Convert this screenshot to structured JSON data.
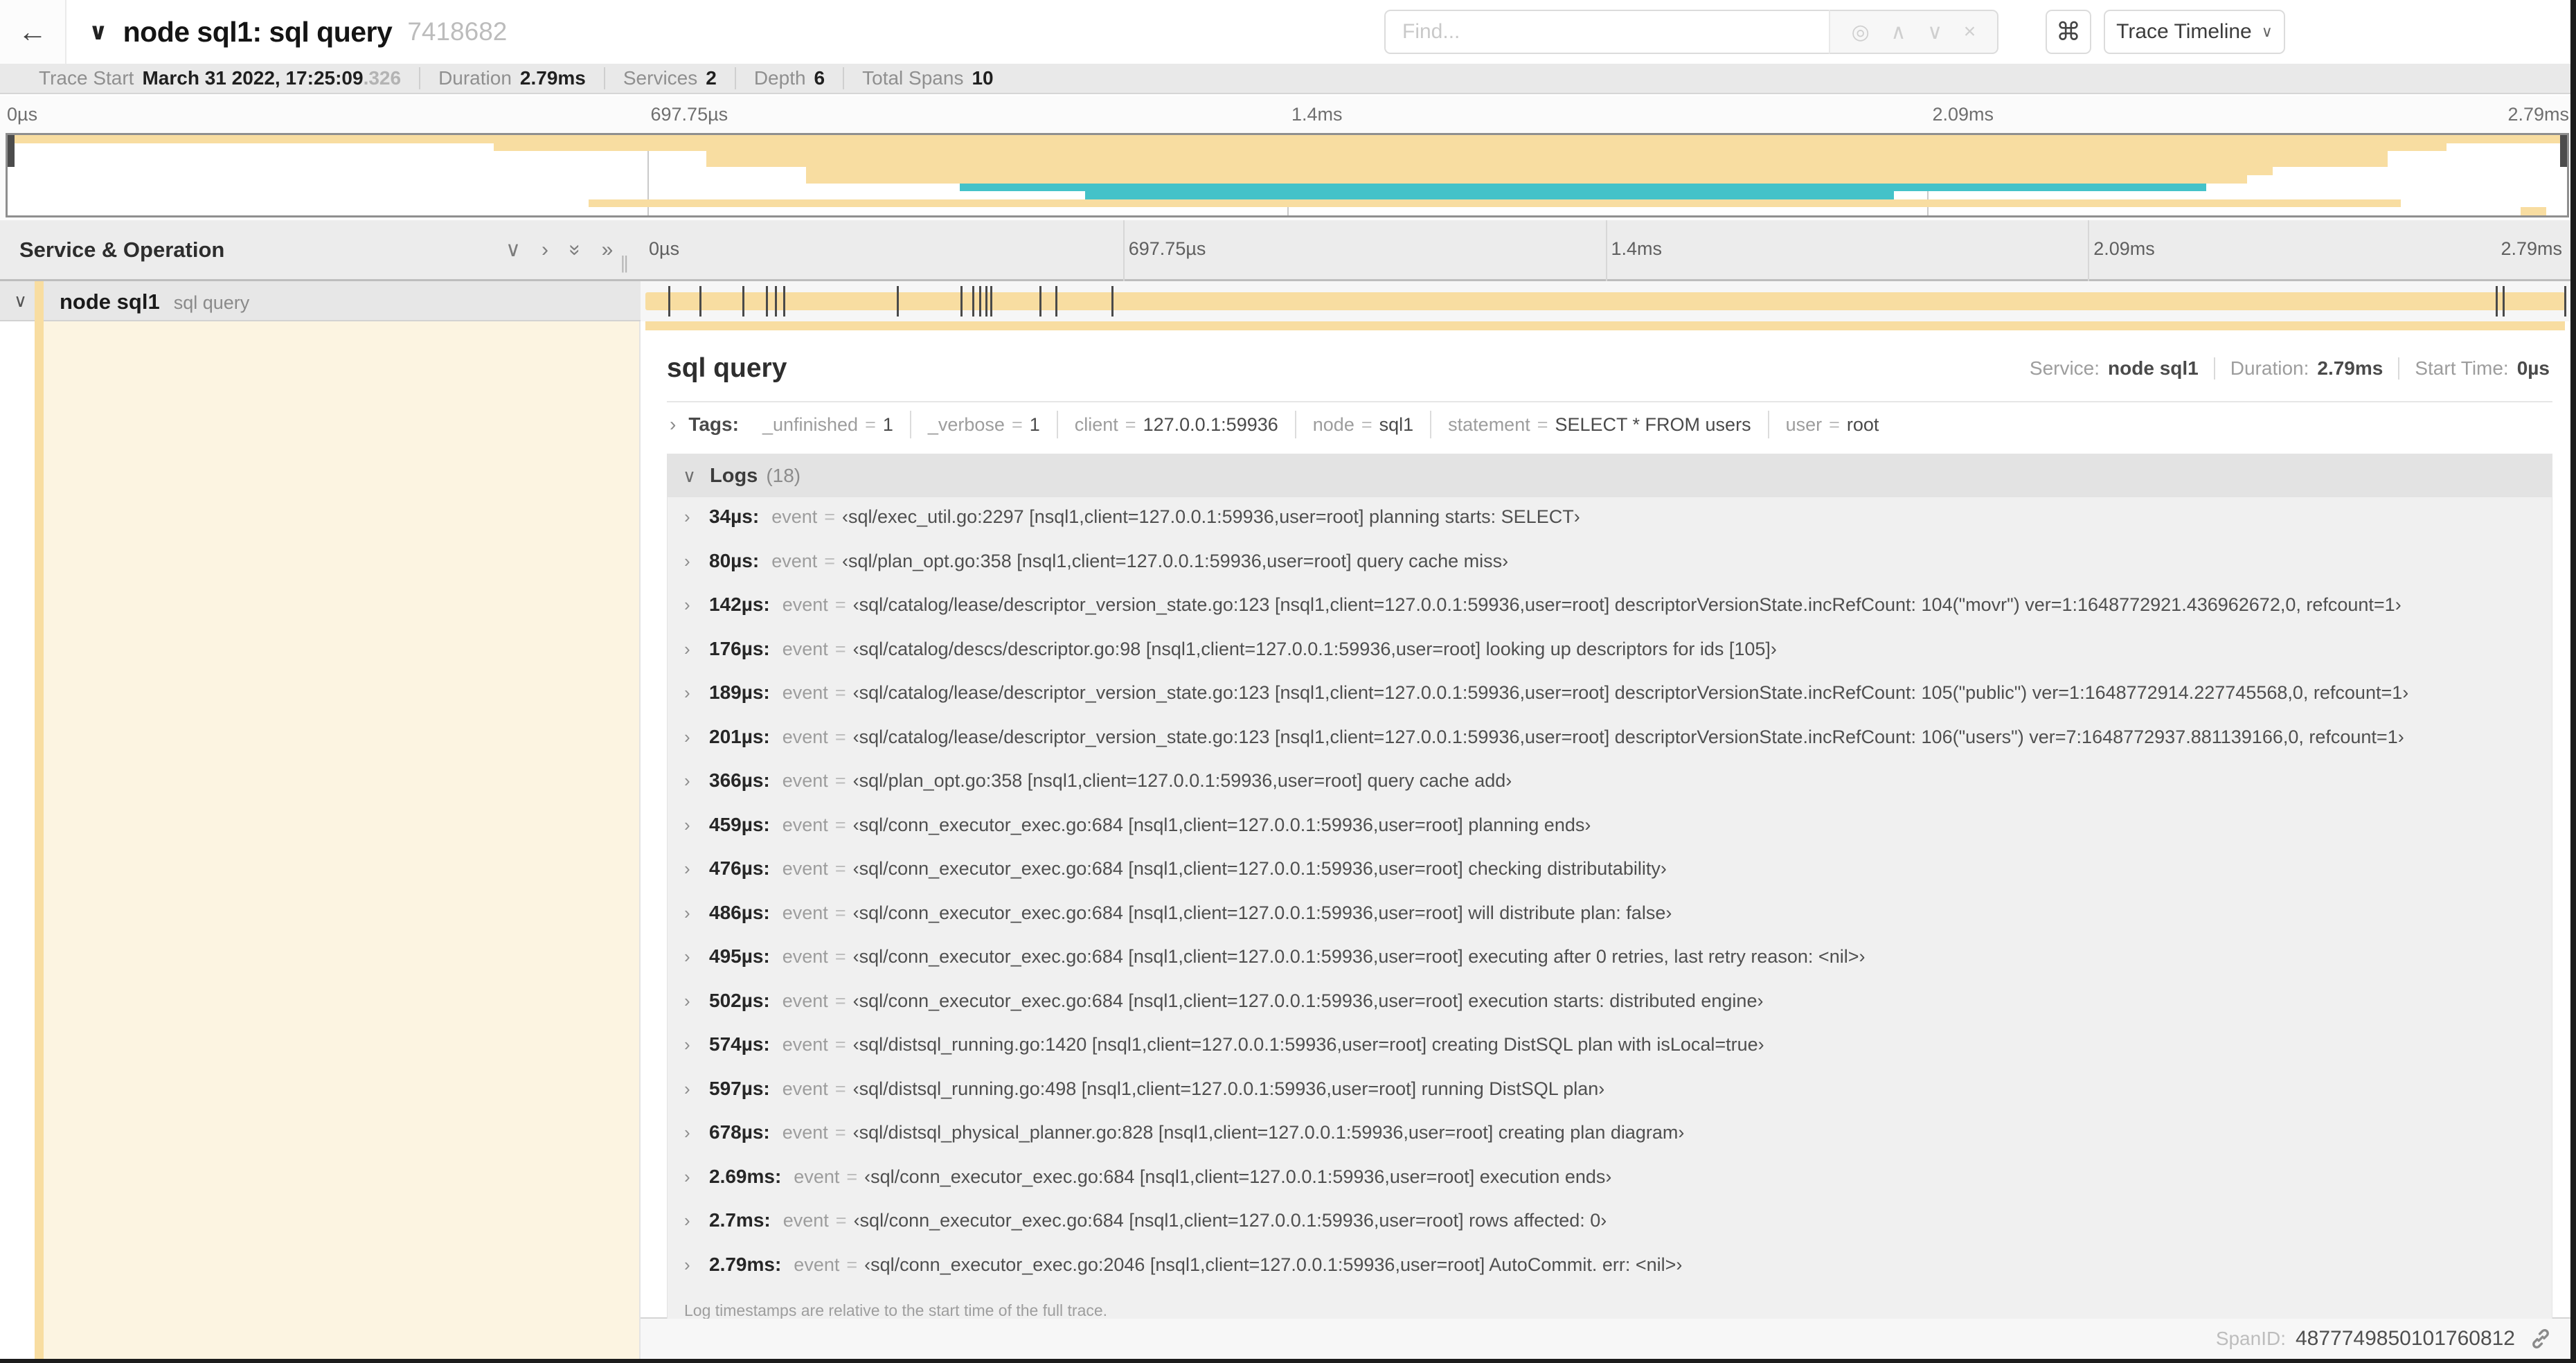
{
  "icons": {
    "back": "←",
    "chevron_down": "∨",
    "chevron_right": "›",
    "double_chevron": "»",
    "locate": "◎",
    "prev": "∧",
    "next": "∨",
    "clear": "×",
    "command": "⌘",
    "grip": "||"
  },
  "header": {
    "title": "node sql1: sql query",
    "trace_id_short": "7418682",
    "find_placeholder": "Find...",
    "view_selector_label": "Trace Timeline"
  },
  "trace_meta": [
    {
      "label": "Trace Start",
      "value": "March 31 2022, 17:25:09",
      "suffix": ".326"
    },
    {
      "label": "Duration",
      "value": "2.79ms"
    },
    {
      "label": "Services",
      "value": "2"
    },
    {
      "label": "Depth",
      "value": "6"
    },
    {
      "label": "Total Spans",
      "value": "10"
    }
  ],
  "trace": {
    "duration_us": 2790
  },
  "ticks": [
    "0µs",
    "697.75µs",
    "1.4ms",
    "2.09ms",
    "2.79ms"
  ],
  "minimap": {
    "rows": 10,
    "spans": [
      {
        "row": 0,
        "start": 0.0,
        "end": 1.0,
        "color": "tan"
      },
      {
        "row": 1,
        "start": 0.19,
        "end": 0.953,
        "color": "tan"
      },
      {
        "row": 2,
        "start": 0.273,
        "end": 0.93,
        "color": "tan"
      },
      {
        "row": 3,
        "start": 0.273,
        "end": 0.93,
        "color": "tan"
      },
      {
        "row": 4,
        "start": 0.312,
        "end": 0.885,
        "color": "tan"
      },
      {
        "row": 5,
        "start": 0.312,
        "end": 0.875,
        "color": "tan"
      },
      {
        "row": 6,
        "start": 0.372,
        "end": 0.859,
        "color": "teal"
      },
      {
        "row": 7,
        "start": 0.421,
        "end": 0.737,
        "color": "teal"
      },
      {
        "row": 8,
        "start": 0.227,
        "end": 0.935,
        "color": "tan"
      },
      {
        "row": 9,
        "start": 0.982,
        "end": 0.992,
        "color": "tan"
      }
    ]
  },
  "timeline_header": {
    "left_title": "Service & Operation"
  },
  "span_row": {
    "service": "node sql1",
    "operation": "sql query"
  },
  "detail": {
    "operation_name": "sql query",
    "meta": [
      {
        "label": "Service:",
        "value": "node sql1"
      },
      {
        "label": "Duration:",
        "value": "2.79ms"
      },
      {
        "label": "Start Time:",
        "value": "0µs"
      }
    ],
    "tags_label": "Tags:",
    "eq": "=",
    "tags": [
      {
        "key": "_unfinished",
        "value": "1"
      },
      {
        "key": "_verbose",
        "value": "1"
      },
      {
        "key": "client",
        "value": "127.0.0.1:59936"
      },
      {
        "key": "node",
        "value": "sql1"
      },
      {
        "key": "statement",
        "value": "SELECT * FROM users"
      },
      {
        "key": "user",
        "value": "root"
      }
    ],
    "logs_label": "Logs",
    "logs_count": "(18)",
    "logs": [
      {
        "t": "34µs:",
        "us": 34,
        "field": "event",
        "value": "‹sql/exec_util.go:2297 [nsql1,client=127.0.0.1:59936,user=root] planning starts: SELECT›"
      },
      {
        "t": "80µs:",
        "us": 80,
        "field": "event",
        "value": "‹sql/plan_opt.go:358 [nsql1,client=127.0.0.1:59936,user=root] query cache miss›"
      },
      {
        "t": "142µs:",
        "us": 142,
        "field": "event",
        "value": "‹sql/catalog/lease/descriptor_version_state.go:123 [nsql1,client=127.0.0.1:59936,user=root] descriptorVersionState.incRefCount: 104(\"movr\") ver=1:1648772921.436962672,0, refcount=1›"
      },
      {
        "t": "176µs:",
        "us": 176,
        "field": "event",
        "value": "‹sql/catalog/descs/descriptor.go:98 [nsql1,client=127.0.0.1:59936,user=root] looking up descriptors for ids [105]›"
      },
      {
        "t": "189µs:",
        "us": 189,
        "field": "event",
        "value": "‹sql/catalog/lease/descriptor_version_state.go:123 [nsql1,client=127.0.0.1:59936,user=root] descriptorVersionState.incRefCount: 105(\"public\") ver=1:1648772914.227745568,0, refcount=1›"
      },
      {
        "t": "201µs:",
        "us": 201,
        "field": "event",
        "value": "‹sql/catalog/lease/descriptor_version_state.go:123 [nsql1,client=127.0.0.1:59936,user=root] descriptorVersionState.incRefCount: 106(\"users\") ver=7:1648772937.881139166,0, refcount=1›"
      },
      {
        "t": "366µs:",
        "us": 366,
        "field": "event",
        "value": "‹sql/plan_opt.go:358 [nsql1,client=127.0.0.1:59936,user=root] query cache add›"
      },
      {
        "t": "459µs:",
        "us": 459,
        "field": "event",
        "value": "‹sql/conn_executor_exec.go:684 [nsql1,client=127.0.0.1:59936,user=root] planning ends›"
      },
      {
        "t": "476µs:",
        "us": 476,
        "field": "event",
        "value": "‹sql/conn_executor_exec.go:684 [nsql1,client=127.0.0.1:59936,user=root] checking distributability›"
      },
      {
        "t": "486µs:",
        "us": 486,
        "field": "event",
        "value": "‹sql/conn_executor_exec.go:684 [nsql1,client=127.0.0.1:59936,user=root] will distribute plan: false›"
      },
      {
        "t": "495µs:",
        "us": 495,
        "field": "event",
        "value": "‹sql/conn_executor_exec.go:684 [nsql1,client=127.0.0.1:59936,user=root] executing after 0 retries, last retry reason: <nil>›"
      },
      {
        "t": "502µs:",
        "us": 502,
        "field": "event",
        "value": "‹sql/conn_executor_exec.go:684 [nsql1,client=127.0.0.1:59936,user=root] execution starts: distributed engine›"
      },
      {
        "t": "574µs:",
        "us": 574,
        "field": "event",
        "value": "‹sql/distsql_running.go:1420 [nsql1,client=127.0.0.1:59936,user=root] creating DistSQL plan with isLocal=true›"
      },
      {
        "t": "597µs:",
        "us": 597,
        "field": "event",
        "value": "‹sql/distsql_running.go:498 [nsql1,client=127.0.0.1:59936,user=root] running DistSQL plan›"
      },
      {
        "t": "678µs:",
        "us": 678,
        "field": "event",
        "value": "‹sql/distsql_physical_planner.go:828 [nsql1,client=127.0.0.1:59936,user=root] creating plan diagram›"
      },
      {
        "t": "2.69ms:",
        "us": 2690,
        "field": "event",
        "value": "‹sql/conn_executor_exec.go:684 [nsql1,client=127.0.0.1:59936,user=root] execution ends›"
      },
      {
        "t": "2.7ms:",
        "us": 2700,
        "field": "event",
        "value": "‹sql/conn_executor_exec.go:684 [nsql1,client=127.0.0.1:59936,user=root] rows affected: 0›"
      },
      {
        "t": "2.79ms:",
        "us": 2790,
        "field": "event",
        "value": "‹sql/conn_executor_exec.go:2046 [nsql1,client=127.0.0.1:59936,user=root] AutoCommit. err: <nil>›"
      }
    ],
    "logs_note": "Log timestamps are relative to the start time of the full trace.",
    "span_id_label": "SpanID:",
    "span_id": "4877749850101760812"
  },
  "colors": {
    "span_tan": "#f8dda1",
    "span_teal": "#44c2c9",
    "detail_cream": "#fcf4e1"
  }
}
